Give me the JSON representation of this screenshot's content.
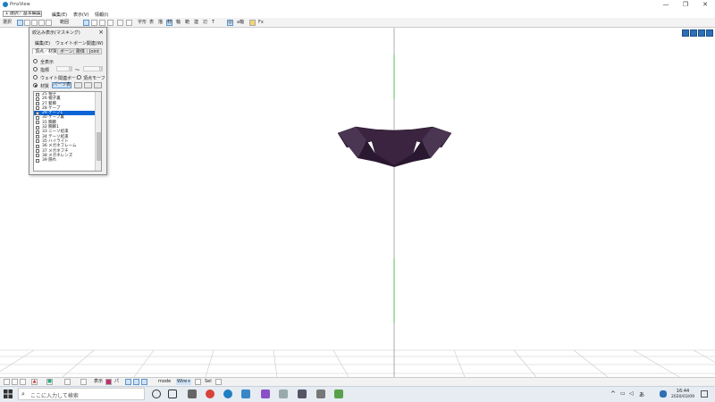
{
  "app": {
    "title": "PmxView",
    "accent": "#1e7fc1"
  },
  "window_controls": {
    "minimize": "—",
    "maximize": "❐",
    "close": "✕"
  },
  "menubar": {
    "mode": "1 選択／基本編集",
    "items": [
      "編集(E)",
      "表示(V)",
      "情報(I)"
    ]
  },
  "toolbar": {
    "items": [
      "選択",
      "範囲",
      "字形",
      "表",
      "描",
      "材",
      "軸",
      "範",
      "連",
      "辺",
      "T",
      "a軸",
      "Fx"
    ]
  },
  "panel": {
    "title": "絞込み表示(マスキング)",
    "close": "×",
    "tabs_top": [
      "編集(E)",
      "ウェイトボーン関連(W)"
    ],
    "tabs": [
      "頂点／材質",
      "ボーン",
      "剛体",
      "Joint"
    ],
    "opt_all": "全表示",
    "opt_index": "指標",
    "index_from": "0",
    "index_tilde": "～",
    "index_to": "0",
    "opt_weight": "ウェイト関連ボーン",
    "opt_morph": "頂点モーフ",
    "opt_material": "材質",
    "part_button": "パーツ表",
    "list": [
      "25 帽子",
      "26 帽子裏",
      "27 髪飾",
      "28 ケープ",
      "29 ケープ1",
      "30 ケープ裏",
      "31 胸飾",
      "32 胸飾1",
      "33 ニーソ結束",
      "34 テーソ結束",
      "35 ハイライト",
      "36 メガネフレーム",
      "37 メガネフチ",
      "38 メガネレンズ",
      "39 隠れ"
    ],
    "selected_index": 4
  },
  "statusbar": {
    "items": [
      "表示",
      "パ",
      "mode",
      "Wire+",
      "Sel"
    ]
  },
  "taskbar": {
    "search_placeholder": "ここに入力して検索",
    "time": "16:44",
    "date": "2020/03/09"
  }
}
